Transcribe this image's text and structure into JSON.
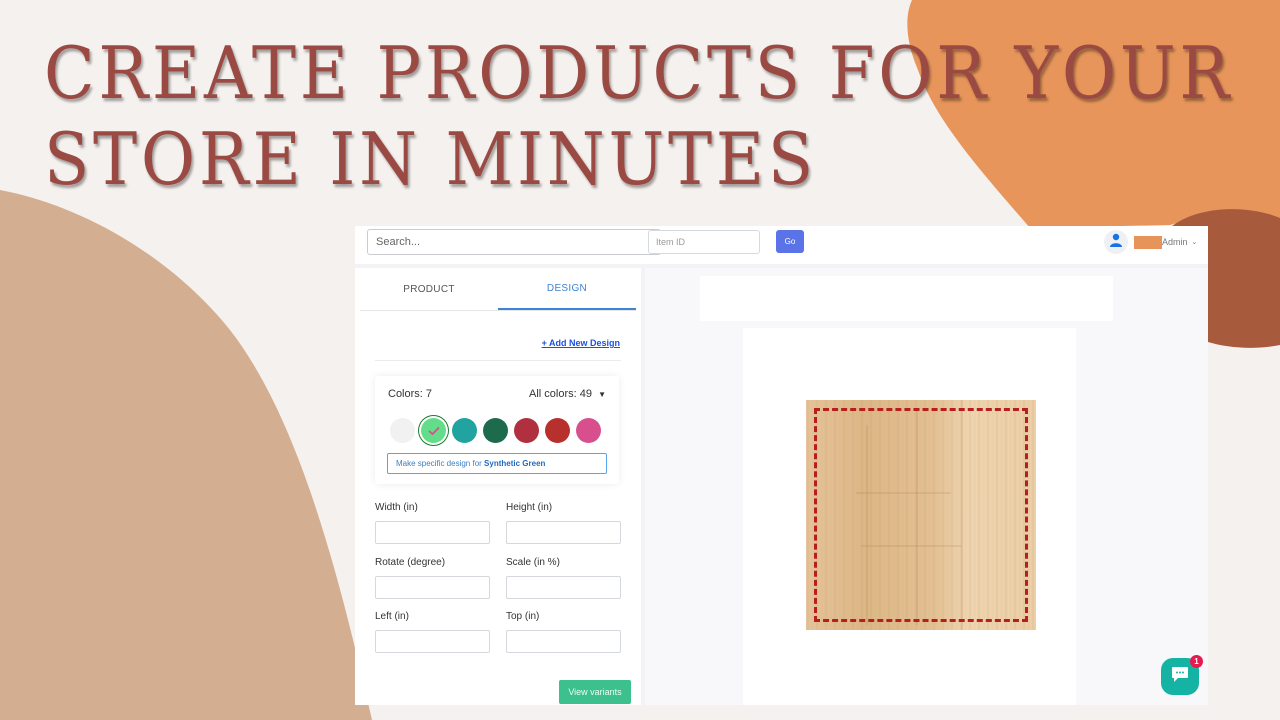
{
  "headline": {
    "line1": "CREATE PRODUCTS FOR YOUR",
    "line2": "STORE IN MINUTES"
  },
  "topbar": {
    "search_placeholder": "Search...",
    "item_id_placeholder": "Item ID",
    "go_label": "Go",
    "user_icon": "user-icon",
    "user_role": "Admin",
    "dropdown_icon": "chevron-down-icon"
  },
  "tabs": [
    {
      "label": "PRODUCT",
      "active": false
    },
    {
      "label": "DESIGN",
      "active": true
    }
  ],
  "design": {
    "add_new_design": "+ Add New Design",
    "colors_label": "Colors: 7",
    "all_colors_label": "All colors: 49",
    "swatches": [
      {
        "color": "#f1f1f1",
        "selected": false
      },
      {
        "color": "#63dd8a",
        "selected": true
      },
      {
        "color": "#21a3a0",
        "selected": false
      },
      {
        "color": "#1d6b4c",
        "selected": false
      },
      {
        "color": "#b03040",
        "selected": false
      },
      {
        "color": "#b8302e",
        "selected": false
      },
      {
        "color": "#d84f8e",
        "selected": false
      }
    ],
    "specific_prefix": "Make specific design for ",
    "specific_color_name": "Synthetic Green"
  },
  "fields": {
    "width_label": "Width (in)",
    "height_label": "Height (in)",
    "rotate_label": "Rotate (degree)",
    "scale_label": "Scale (in %)",
    "left_label": "Left (in)",
    "top_label": "Top (in)",
    "width_value": "",
    "height_value": "",
    "rotate_value": "",
    "scale_value": "",
    "left_value": "",
    "top_value": ""
  },
  "view_variants_label": "View variants",
  "chat": {
    "icon": "chat-bubble-icon",
    "badge_count": "1"
  },
  "colors": {
    "headline": "#9a4a42",
    "accent_blue": "#3c84d4",
    "go_button": "#5a73e8",
    "view_variants": "#3cc08e",
    "chat_button": "#14b3a3",
    "cut_line": "#b71f1f"
  }
}
